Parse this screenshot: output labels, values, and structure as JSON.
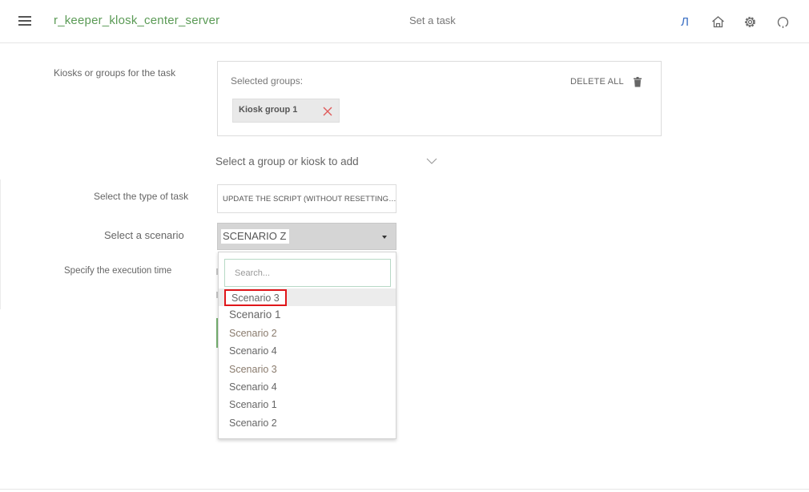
{
  "header": {
    "app_title": "r_keeper_klosk_center_server",
    "page_title": "Set a task",
    "lang_label": "Л",
    "icons": [
      "menu-icon",
      "home-icon",
      "gear-icon",
      "power-icon"
    ]
  },
  "form": {
    "kiosks_label": "Kiosks or groups for the task",
    "selected_groups_label": "Selected groups:",
    "delete_all_label": "DELETE ALL",
    "selected_groups": [
      "Kiosk group 1"
    ],
    "add_placeholder": "Select a group or kiosk to add",
    "task_type_label": "Select the type of task",
    "task_type_value": "UPDATE THE SCRIPT (WITHOUT RESETTING…",
    "scenario_label": "Select a scenario",
    "scenario_value": "SCENARIO Z",
    "execution_time_label": "Specify the execution time"
  },
  "dropdown": {
    "search_placeholder": "Search...",
    "options": [
      "Scenario 3",
      "Scenario 1",
      "Scenario 2",
      "Scenario 4",
      "Scenario 3",
      "Scenario 4",
      "Scenario 1",
      "Scenario 2"
    ],
    "highlighted_index": 0
  },
  "colors": {
    "accent_green": "#5a9a55",
    "link_blue": "#3a6fc4",
    "highlight_red": "#e0161a",
    "search_border": "#b7d9c6"
  }
}
